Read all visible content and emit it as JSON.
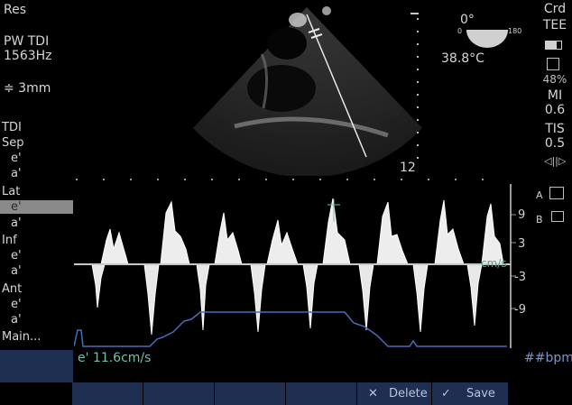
{
  "top_left": {
    "preset": "Res",
    "mode": "PW TDI",
    "prf": "1563Hz",
    "gate_label": "≑ 3mm"
  },
  "top_right": {
    "angle": "0°",
    "angle_min": "0",
    "angle_max": "180",
    "temperature": "38.8°C",
    "app": "Crd",
    "probe": "TEE",
    "storage_pct": "48%",
    "mi_label": "MI",
    "mi_value": "0.6",
    "tis_label": "TIS",
    "tis_value": "0.5"
  },
  "image": {
    "depth": "12",
    "side_a": "A",
    "side_b": "B"
  },
  "menu": {
    "title": "TDI",
    "groups": [
      {
        "label": "Sep",
        "items": [
          "e'",
          "a'"
        ]
      },
      {
        "label": "Lat",
        "items": [
          "e'",
          "a'"
        ],
        "selected": 0
      },
      {
        "label": "Inf",
        "items": [
          "e'",
          "a'"
        ]
      },
      {
        "label": "Ant",
        "items": [
          "e'",
          "a'"
        ]
      }
    ],
    "main": "Main..."
  },
  "spectral": {
    "scale_labels": [
      "9",
      "3",
      "-3",
      "-9"
    ],
    "unit": "cm/s",
    "measurement": "e' 11.6cm/s",
    "heart_rate": "##bpm"
  },
  "buttons": {
    "delete": "Delete",
    "save": "Save"
  },
  "colors": {
    "measurement": "#6dc2a9",
    "ecg_trace": "#4a6bb8",
    "button_bg": "#1f2f52"
  }
}
